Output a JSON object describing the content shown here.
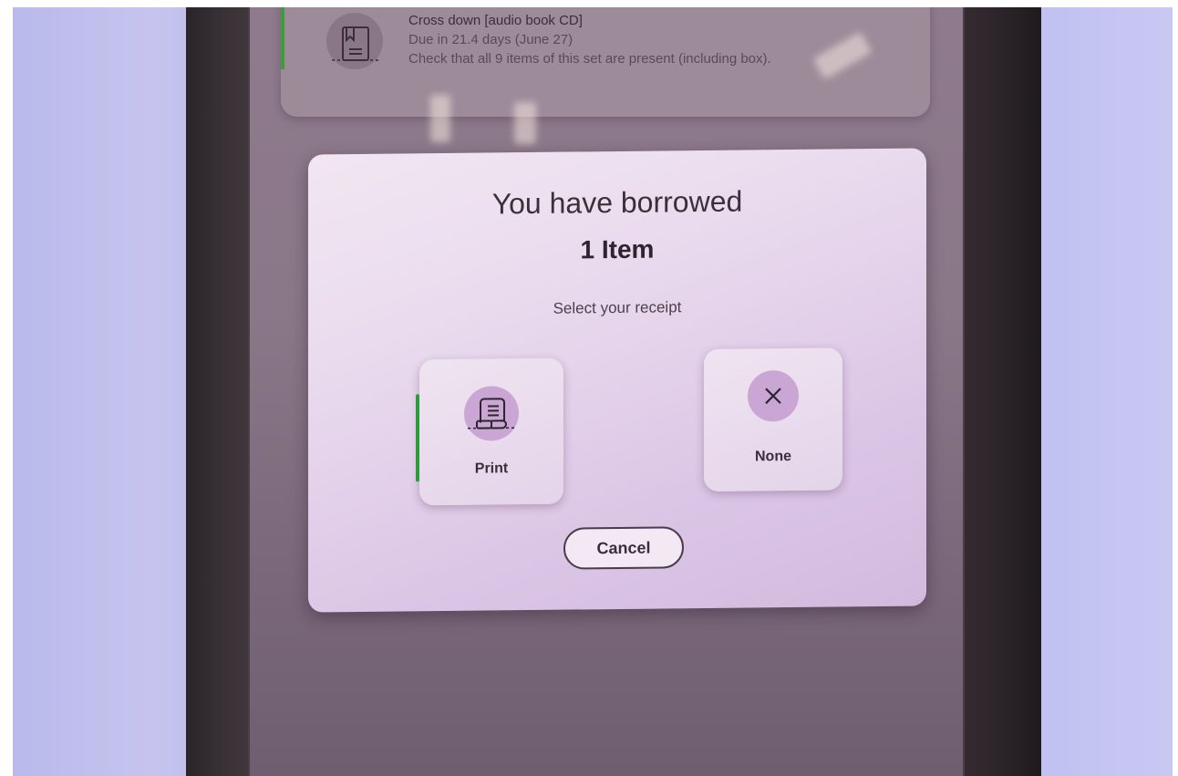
{
  "item": {
    "title": "Cross down [audio book CD]",
    "due": "Due in 21.4 days (June 27)",
    "note": "Check that all 9 items of this set are present (including box)."
  },
  "dialog": {
    "title": "You have borrowed",
    "count": "1 Item",
    "prompt": "Select your receipt",
    "options": [
      {
        "label": "Print",
        "icon": "receipt-scroll-icon"
      },
      {
        "label": "None",
        "icon": "close-x-icon"
      }
    ],
    "cancel_label": "Cancel"
  },
  "colors": {
    "accent_green": "#2f9a3a",
    "dialog_bg": "#eadcee",
    "icon_circle": "#caa6d4"
  }
}
